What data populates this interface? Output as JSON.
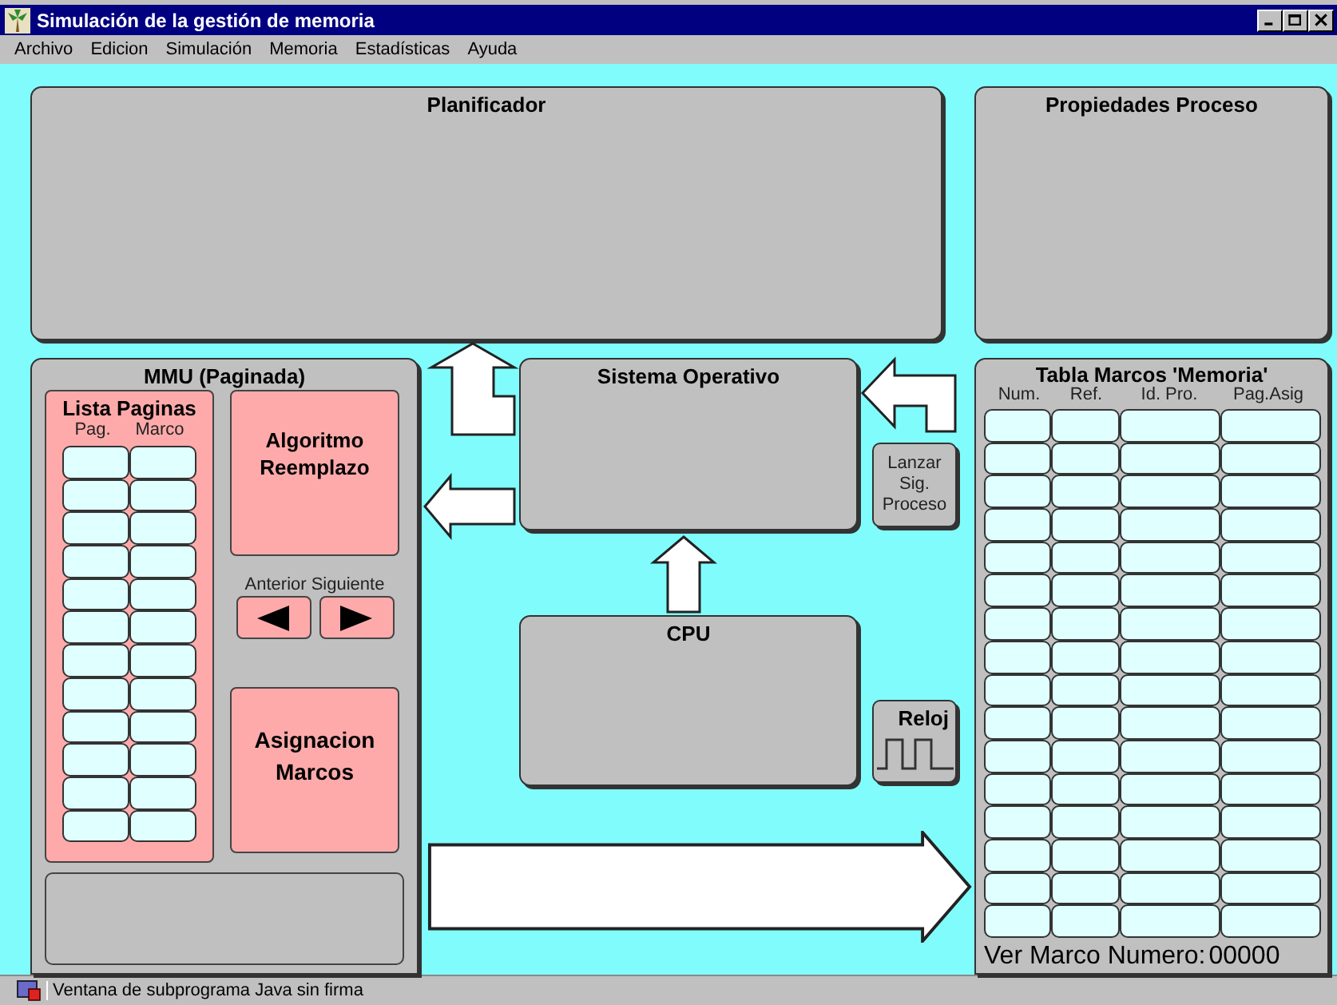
{
  "window": {
    "title": "Simulación de la gestión de memoria"
  },
  "menu": [
    "Archivo",
    "Edicion",
    "Simulación",
    "Memoria",
    "Estadísticas",
    "Ayuda"
  ],
  "planificador": {
    "title": "Planificador"
  },
  "propiedades": {
    "title": "Propiedades Proceso"
  },
  "mmu": {
    "title": "MMU (Paginada)",
    "page_list": {
      "title": "Lista Paginas",
      "columns": [
        "Pag.",
        "Marco"
      ]
    },
    "algorithm": "Algoritmo Reemplazo",
    "prev_label": "Anterior",
    "next_label": "Siguiente",
    "assignment": "Asignacion Marcos"
  },
  "sistema_operativo": {
    "title": "Sistema Operativo"
  },
  "launch_button": "Lanzar Sig. Proceso",
  "cpu": {
    "title": "CPU"
  },
  "clock": {
    "title": "Reloj"
  },
  "frames": {
    "title": "Tabla Marcos 'Memoria'",
    "columns": [
      "Num.",
      "Ref.",
      "Id. Pro.",
      "Pag.Asig"
    ],
    "footer_label": "Ver Marco Numero:",
    "footer_value": "00000"
  },
  "status_bar": "Ventana de subprograma Java sin firma"
}
